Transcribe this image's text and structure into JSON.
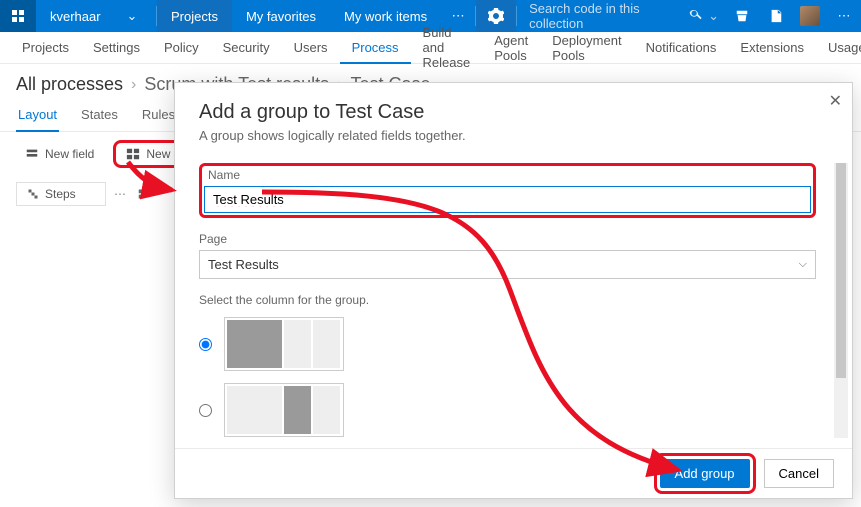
{
  "topbar": {
    "account": "kverhaar",
    "nav": {
      "projects": "Projects",
      "favorites": "My favorites",
      "work_items": "My work items"
    },
    "search_placeholder": "Search code in this collection"
  },
  "submenu": {
    "items": [
      "Projects",
      "Settings",
      "Policy",
      "Security",
      "Users",
      "Process",
      "Build and Release",
      "Agent Pools",
      "Deployment Pools",
      "Notifications",
      "Extensions",
      "Usage"
    ],
    "active_index": 5
  },
  "breadcrumb": {
    "root": "All processes",
    "mid": "Scrum with Test results",
    "leaf": "Test Case"
  },
  "pagetabs": {
    "items": [
      "Layout",
      "States",
      "Rules"
    ],
    "active_index": 0
  },
  "designer": {
    "new_field": "New field",
    "new_group": "New group",
    "steps": "Steps"
  },
  "modal": {
    "title": "Add a group to Test Case",
    "subtitle": "A group shows logically related fields together.",
    "name_label": "Name",
    "name_value": "Test Results",
    "page_label": "Page",
    "page_value": "Test Results",
    "column_hint": "Select the column for the group.",
    "primary": "Add group",
    "cancel": "Cancel"
  },
  "colors": {
    "brand": "#0078d4",
    "annotate": "#e81123"
  }
}
